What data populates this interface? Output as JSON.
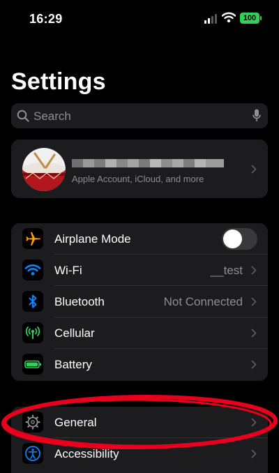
{
  "status_bar": {
    "time": "16:29",
    "battery": "100"
  },
  "page": {
    "title": "Settings"
  },
  "search": {
    "placeholder": "Search"
  },
  "account": {
    "subtitle": "Apple Account, iCloud, and more"
  },
  "group_one": [
    {
      "label": "Airplane Mode",
      "value": "",
      "icon": "airplane-icon",
      "control": "toggle",
      "toggle_on": false
    },
    {
      "label": "Wi-Fi",
      "value": "__test",
      "icon": "wifi-icon",
      "control": "chevron"
    },
    {
      "label": "Bluetooth",
      "value": "Not Connected",
      "icon": "bluetooth-icon",
      "control": "chevron"
    },
    {
      "label": "Cellular",
      "value": "",
      "icon": "cellular-icon",
      "control": "chevron"
    },
    {
      "label": "Battery",
      "value": "",
      "icon": "battery-icon",
      "control": "chevron"
    }
  ],
  "group_two": [
    {
      "label": "General",
      "icon": "gear-icon",
      "control": "chevron"
    },
    {
      "label": "Accessibility",
      "icon": "accessibility-icon",
      "control": "chevron"
    }
  ],
  "colors": {
    "background": "#000000",
    "cell": "#1c1c1e",
    "airplane": "#ff9f0a",
    "wifi": "#0a84ff",
    "bluetooth": "#0a84ff",
    "cellular": "#30d158",
    "battery": "#30d158",
    "annotation": "#e8001c"
  }
}
